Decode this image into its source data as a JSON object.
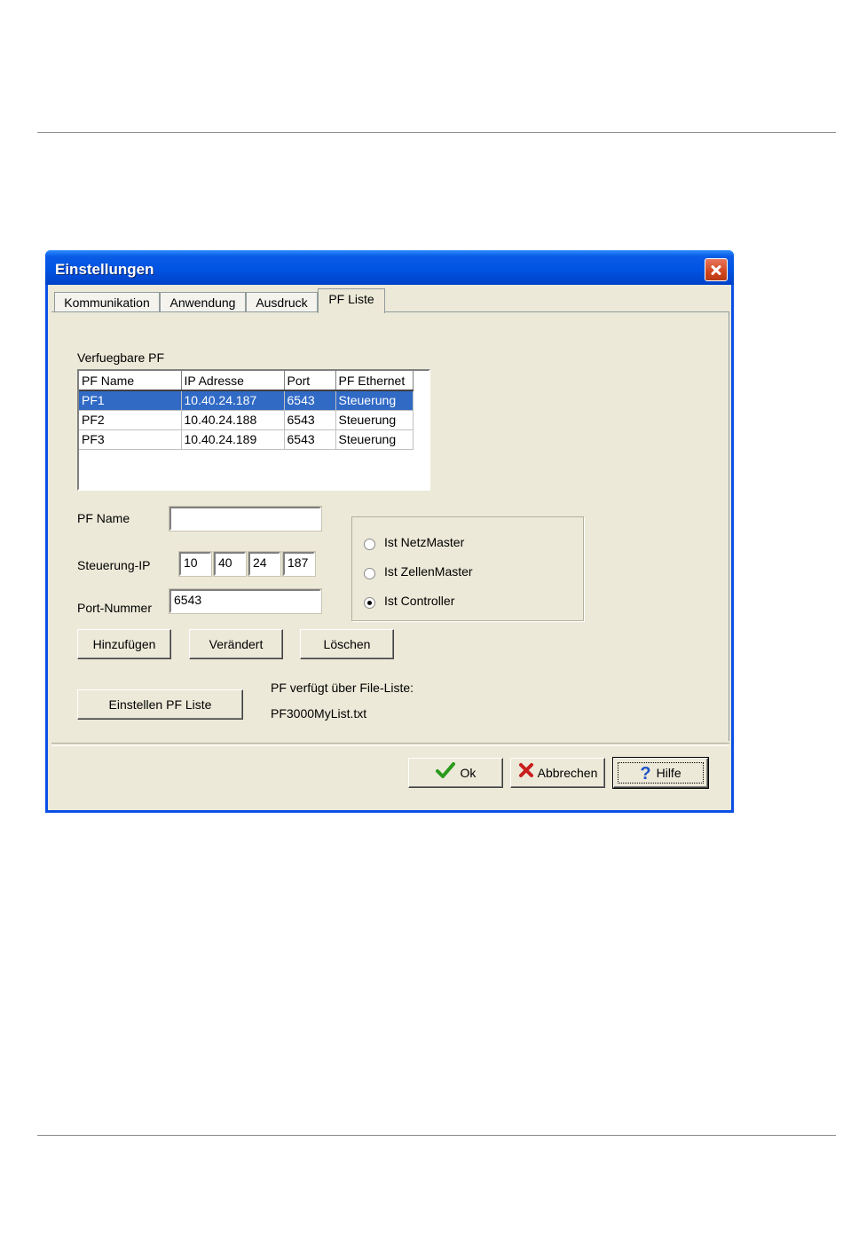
{
  "dialog": {
    "title": "Einstellungen",
    "close_icon": "close-icon"
  },
  "tabs": [
    "Kommunikation",
    "Anwendung",
    "Ausdruck",
    "PF Liste"
  ],
  "active_tab": "PF Liste",
  "list": {
    "label": "Verfuegbare PF",
    "columns": [
      "PF Name",
      "IP Adresse",
      "Port",
      "PF Ethernet"
    ],
    "rows": [
      [
        "PF1",
        "10.40.24.187",
        "6543",
        "Steuerung"
      ],
      [
        "PF2",
        "10.40.24.188",
        "6543",
        "Steuerung"
      ],
      [
        "PF3",
        "10.40.24.189",
        "6543",
        "Steuerung"
      ]
    ],
    "selected_row": "PF1"
  },
  "form": {
    "name_label": "PF Name",
    "name_value": "",
    "ip_label": "Steuerung-IP",
    "ip_parts": [
      "10",
      "40",
      "24",
      "187"
    ],
    "port_label": "Port-Nummer",
    "port_value": "6543"
  },
  "roles": {
    "options": [
      "Ist NetzMaster",
      "Ist ZellenMaster",
      "Ist Controller"
    ],
    "selected": "Ist Controller"
  },
  "actions": {
    "add": "Hinzufügen",
    "change": "Verändert",
    "delete": "Löschen",
    "set_list": "Einstellen PF Liste"
  },
  "file_info": {
    "label": "PF verfügt über File-Liste:",
    "filename": "PF3000MyList.txt"
  },
  "footer": {
    "ok": "Ok",
    "cancel": "Abbrechen",
    "help": "Hilfe",
    "ok_color": "#2a9a1c",
    "cancel_color": "#c81e1e",
    "help_color": "#1c52c8"
  }
}
